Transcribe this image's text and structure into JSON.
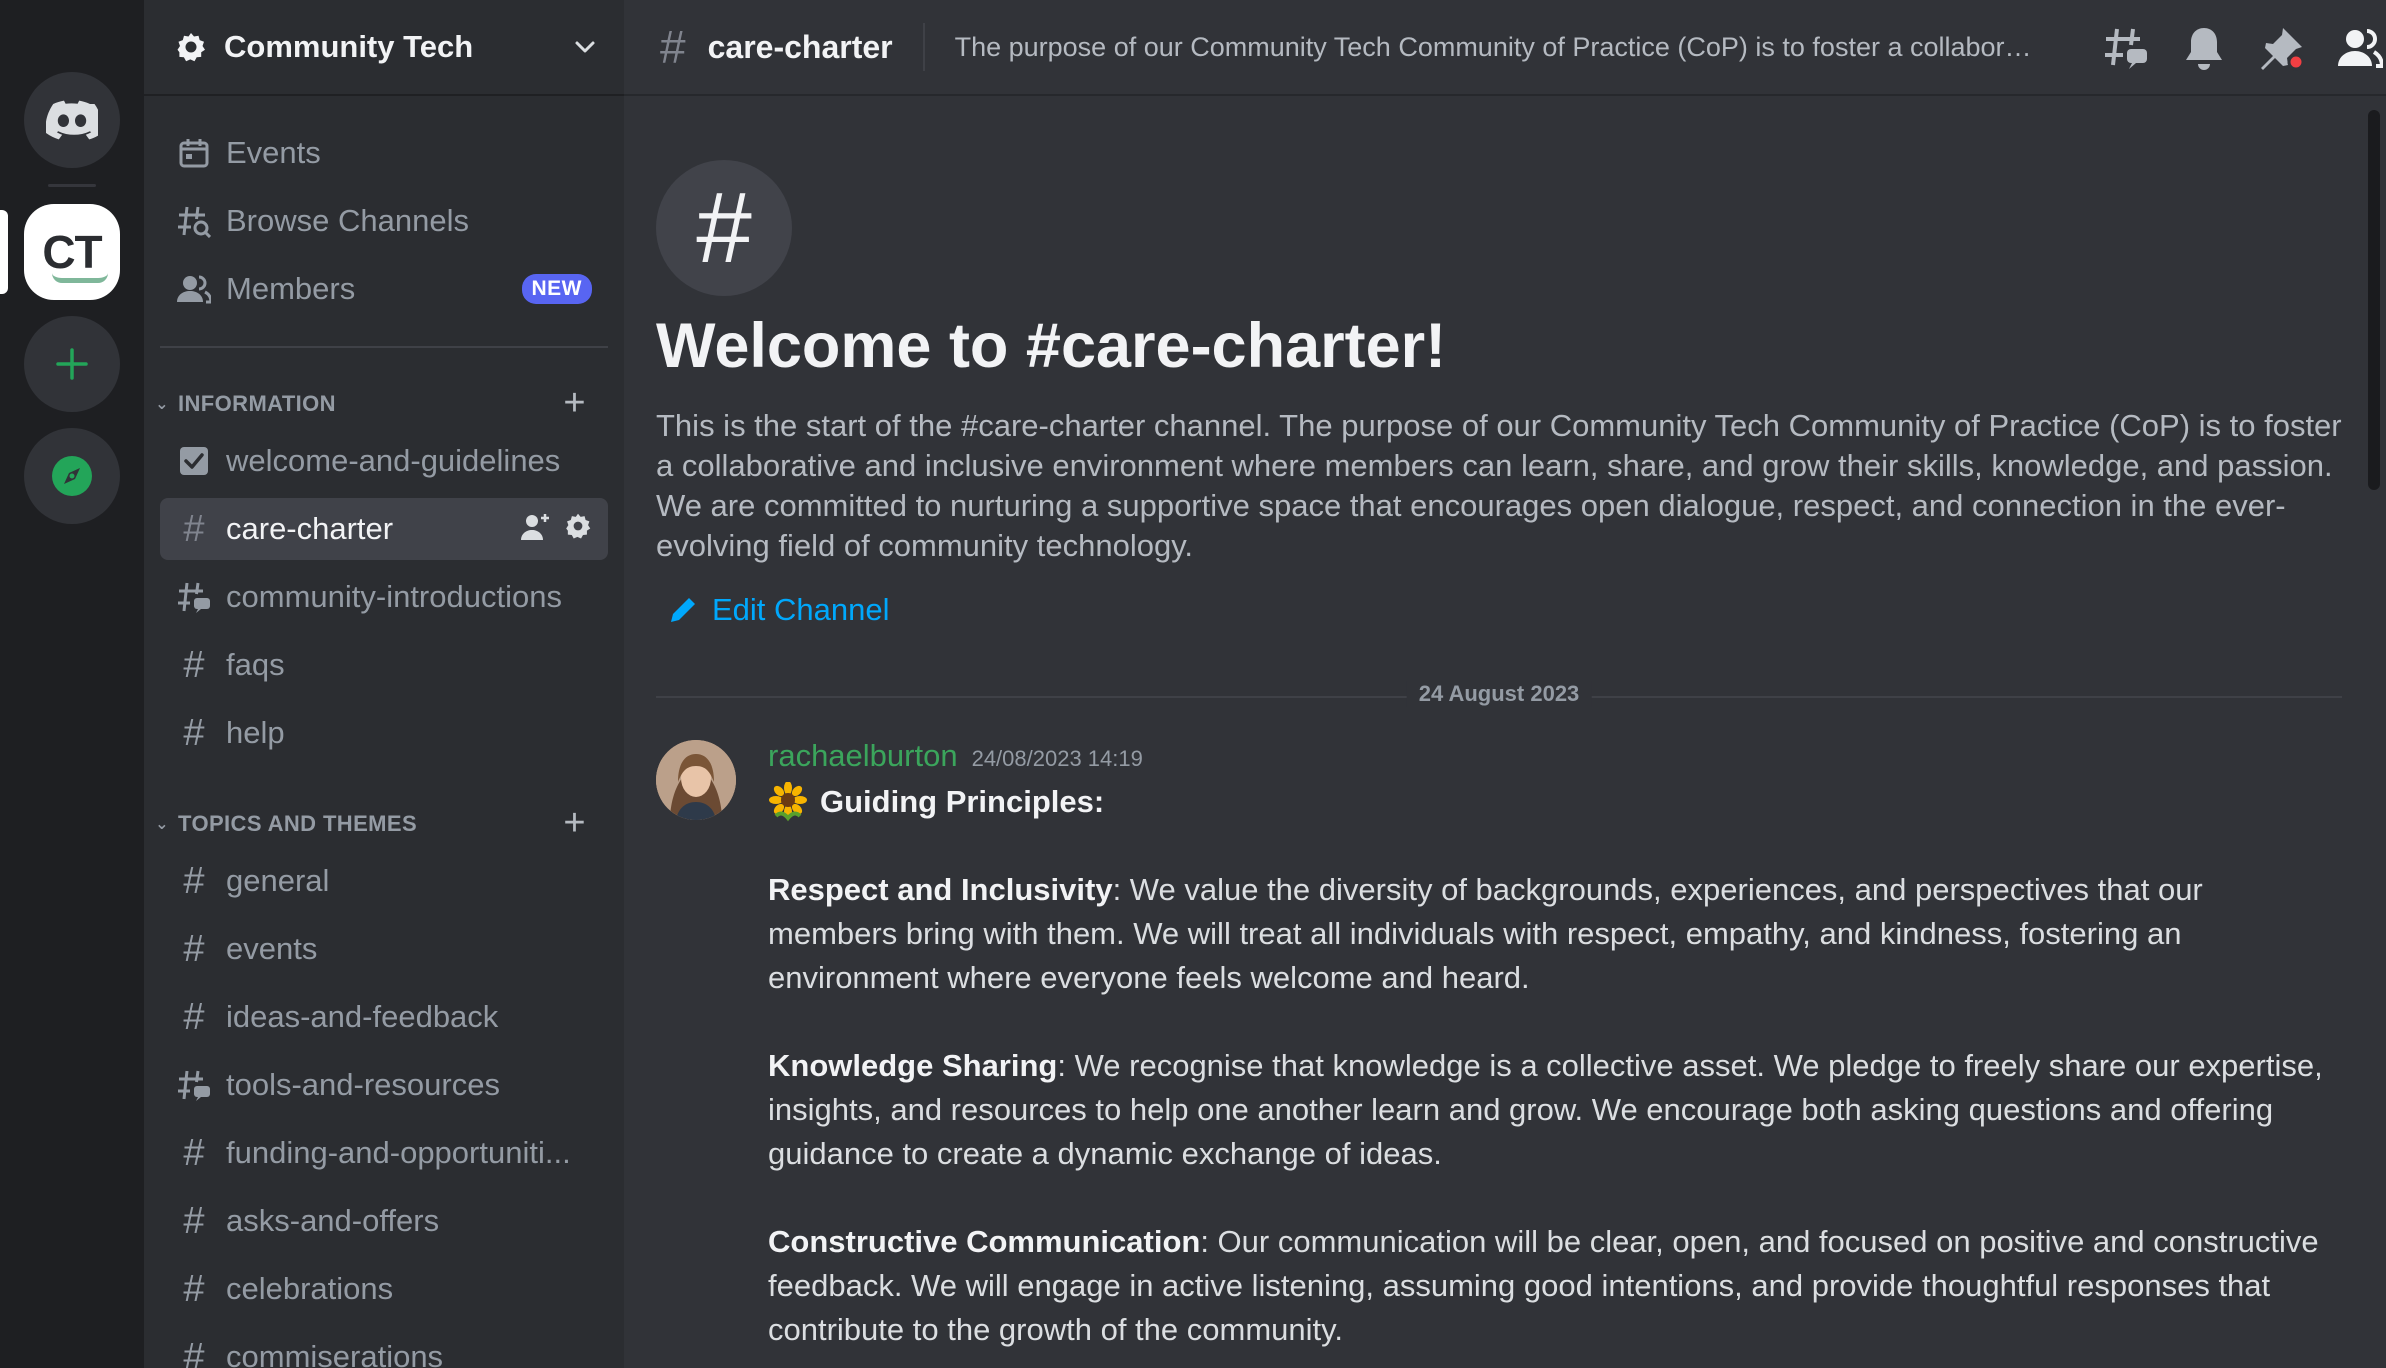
{
  "server": {
    "name": "Community Tech",
    "logo_text": "CT"
  },
  "sidebar": {
    "nav": [
      {
        "label": "Events",
        "icon": "calendar-icon"
      },
      {
        "label": "Browse Channels",
        "icon": "browse-channels-icon"
      },
      {
        "label": "Members",
        "icon": "members-icon",
        "badge": "NEW"
      }
    ],
    "categories": [
      {
        "name": "INFORMATION",
        "channels": [
          {
            "name": "welcome-and-guidelines",
            "icon": "rules-checkbox-icon"
          },
          {
            "name": "care-charter",
            "icon": "hash-icon",
            "active": true
          },
          {
            "name": "community-introductions",
            "icon": "thread-hash-icon"
          },
          {
            "name": "faqs",
            "icon": "hash-icon"
          },
          {
            "name": "help",
            "icon": "hash-icon"
          }
        ]
      },
      {
        "name": "TOPICS AND THEMES",
        "channels": [
          {
            "name": "general",
            "icon": "hash-icon"
          },
          {
            "name": "events",
            "icon": "hash-icon"
          },
          {
            "name": "ideas-and-feedback",
            "icon": "hash-icon"
          },
          {
            "name": "tools-and-resources",
            "icon": "thread-hash-icon"
          },
          {
            "name": "funding-and-opportuniti...",
            "icon": "hash-icon"
          },
          {
            "name": "asks-and-offers",
            "icon": "hash-icon"
          },
          {
            "name": "celebrations",
            "icon": "hash-icon"
          },
          {
            "name": "commiserations",
            "icon": "hash-icon"
          }
        ]
      }
    ]
  },
  "topbar": {
    "channel": "care-charter",
    "topic": "The purpose of our Community Tech Community of Practice (CoP) is to foster a collaborative and inclusive environment where members can learn, share, and grow their skills, knowledge, and passion."
  },
  "welcome": {
    "title": "Welcome to #care-charter!",
    "description": "This is the start of the #care-charter channel. The purpose of our Community Tech Community of Practice (CoP) is to foster a collaborative and inclusive environment where members can learn, share, and grow their skills, knowledge, and passion. We are committed to nurturing a supportive space that encourages open dialogue, respect, and connection in the ever-evolving field of community technology.",
    "edit_label": "Edit Channel"
  },
  "date_divider": "24 August 2023",
  "message": {
    "author": "rachaelburton",
    "timestamp": "24/08/2023 14:19",
    "heading": "Guiding Principles:",
    "principles": [
      {
        "title": "Respect and Inclusivity",
        "text": ": We value the diversity of backgrounds, experiences, and perspectives that our members bring with them. We will treat all individuals with respect, empathy, and kindness, fostering an environment where everyone feels welcome and heard."
      },
      {
        "title": "Knowledge Sharing",
        "text": ": We recognise that knowledge is a collective asset. We pledge to freely share our expertise, insights, and resources to help one another learn and grow. We encourage both asking questions and offering guidance to create a dynamic exchange of ideas."
      },
      {
        "title": "Constructive Communication",
        "text": ": Our communication will be clear, open, and focused on positive and constructive feedback. We will engage in active listening, assuming good intentions, and provide thoughtful responses that contribute to the growth of the community."
      }
    ]
  },
  "colors": {
    "accent": "#5865f2",
    "link": "#00a8fc",
    "author": "#3ba55c",
    "background": "#313338",
    "sidebar": "#2b2d31",
    "rail": "#1e1f22",
    "notification_dot": "#f23f43"
  }
}
